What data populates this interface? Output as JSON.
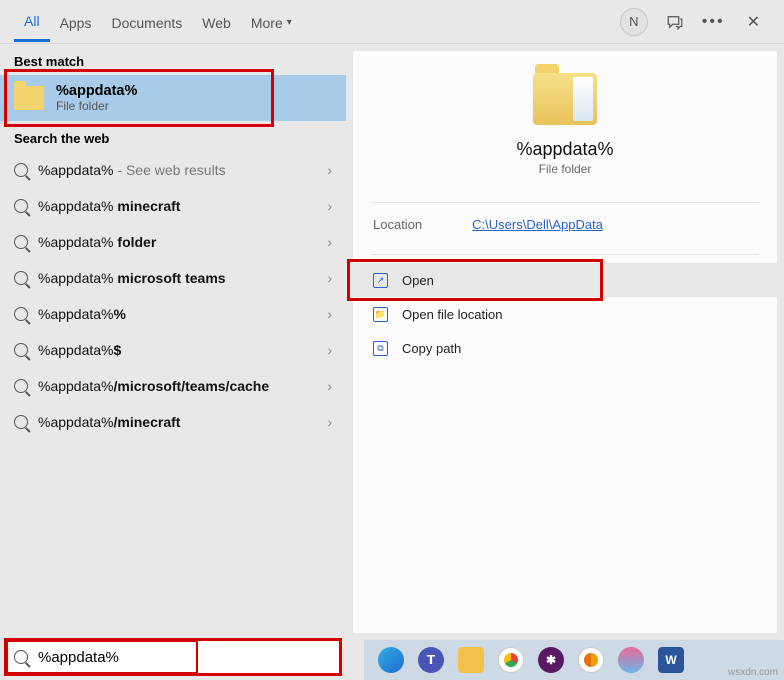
{
  "tabs": {
    "all": "All",
    "apps": "Apps",
    "documents": "Documents",
    "web": "Web",
    "more": "More"
  },
  "user_initial": "N",
  "sections": {
    "best_match": "Best match",
    "search_web": "Search the web"
  },
  "best_match": {
    "title": "%appdata%",
    "subtitle": "File folder"
  },
  "web_results": [
    {
      "prefix": "%appdata%",
      "suffix": "",
      "muted": " - See web results"
    },
    {
      "prefix": "%appdata% ",
      "suffix": "minecraft",
      "muted": ""
    },
    {
      "prefix": "%appdata% ",
      "suffix": "folder",
      "muted": ""
    },
    {
      "prefix": "%appdata% ",
      "suffix": "microsoft teams",
      "muted": ""
    },
    {
      "prefix": "%appdata%",
      "suffix": "%",
      "muted": ""
    },
    {
      "prefix": "%appdata%",
      "suffix": "$",
      "muted": ""
    },
    {
      "prefix": "%appdata%",
      "suffix": "/microsoft/teams/cache",
      "muted": ""
    },
    {
      "prefix": "%appdata%",
      "suffix": "/minecraft",
      "muted": ""
    }
  ],
  "preview": {
    "title": "%appdata%",
    "subtitle": "File folder",
    "location_label": "Location",
    "location_value": "C:\\Users\\Dell\\AppData"
  },
  "actions": {
    "open": "Open",
    "open_file_location": "Open file location",
    "copy_path": "Copy path"
  },
  "search_value": "%appdata%",
  "watermark": "wsxdn.com"
}
